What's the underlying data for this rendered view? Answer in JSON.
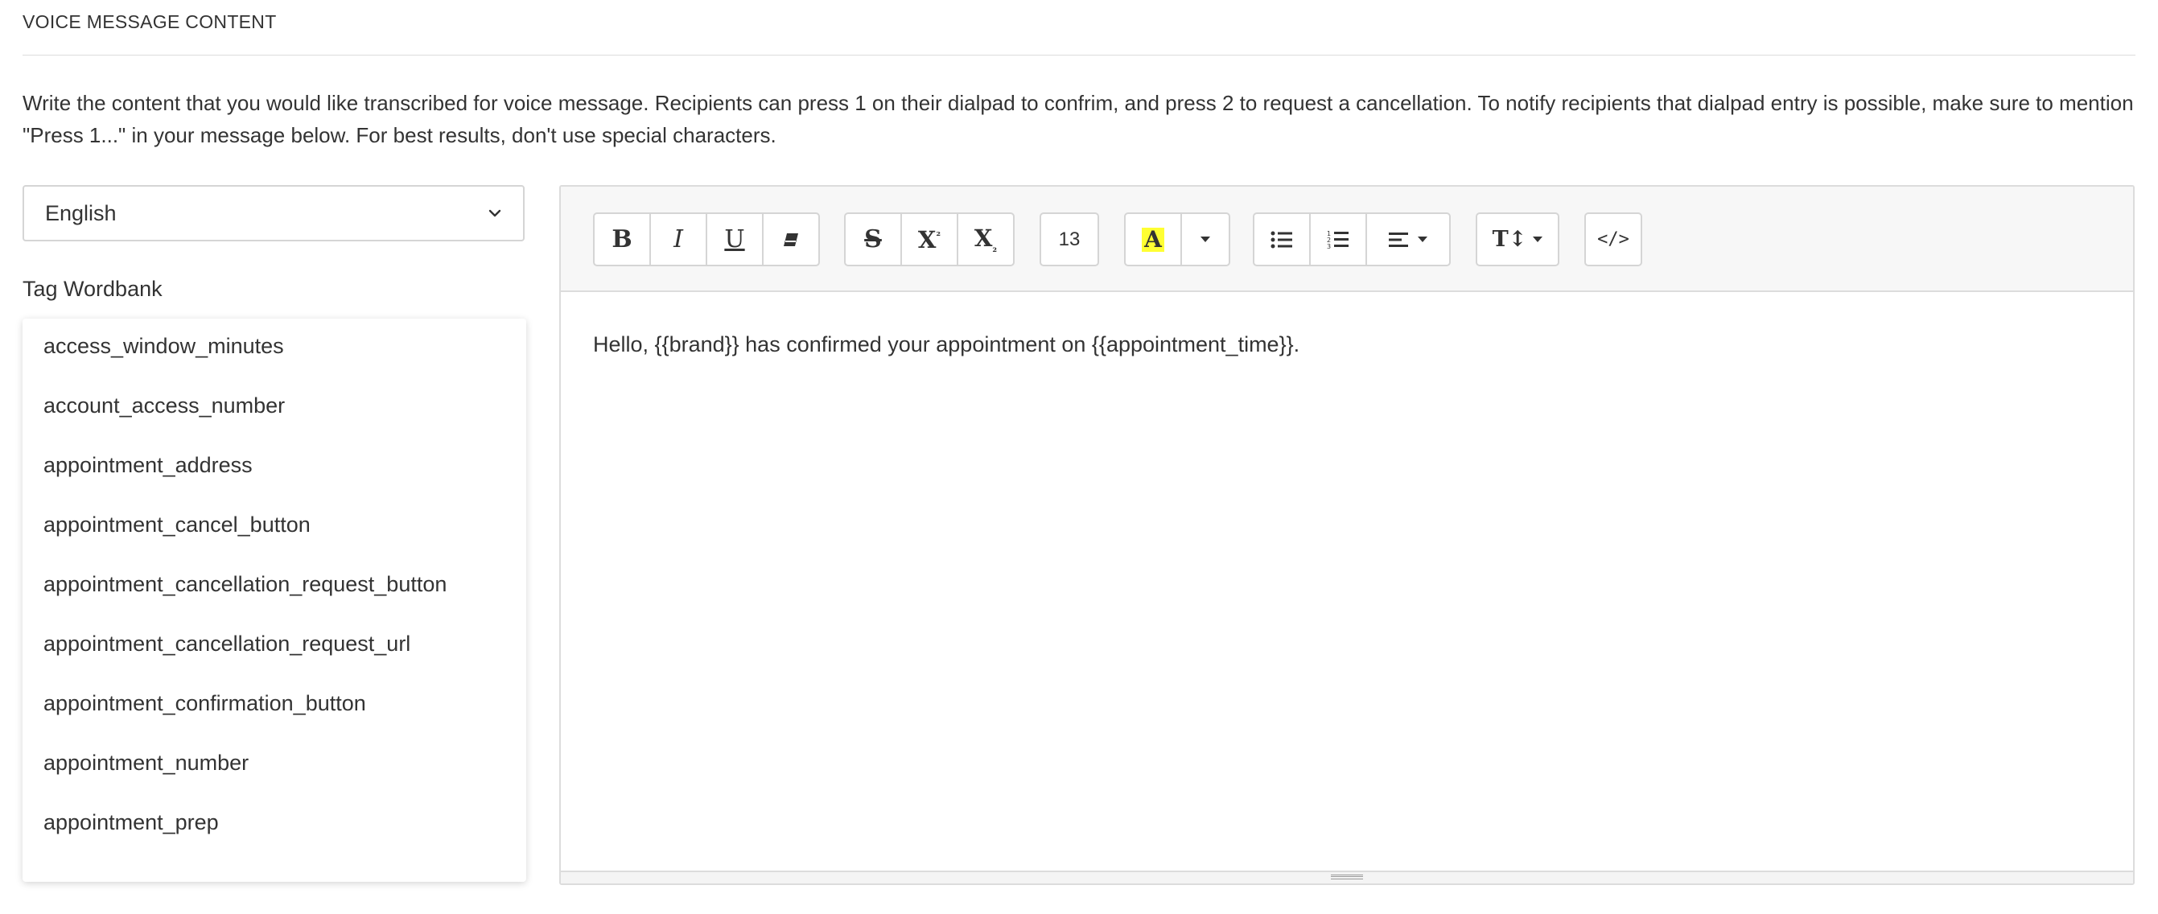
{
  "section": {
    "title": "VOICE MESSAGE CONTENT",
    "description": "Write the content that you would like transcribed for voice message. Recipients can press 1 on their dialpad to confrim, and press 2 to request a cancellation. To notify recipients that dialpad entry is possible, make sure to mention \"Press 1...\" in your message below. For best results, don't use special characters."
  },
  "language_select": {
    "value": "English",
    "icon": "chevron-down-icon"
  },
  "wordbank": {
    "label": "Tag Wordbank",
    "items": [
      "access_window_minutes",
      "account_access_number",
      "appointment_address",
      "appointment_cancel_button",
      "appointment_cancellation_request_button",
      "appointment_cancellation_request_url",
      "appointment_confirmation_button",
      "appointment_number",
      "appointment_prep"
    ]
  },
  "toolbar": {
    "bold": "B",
    "italic": "I",
    "underline": "U",
    "eraser_icon": "eraser-icon",
    "strikethrough": "S",
    "superscript": "X",
    "superscript_mark": "²",
    "subscript": "X",
    "subscript_mark": "₂",
    "font_size": "13",
    "highlight": "A",
    "highlight_color": "#ffff33",
    "bullet_list_icon": "bullet-list-icon",
    "numbered_list_icon": "numbered-list-icon",
    "align_icon": "align-left-icon",
    "text_height": "T↕",
    "code_view": "</>"
  },
  "editor": {
    "content": "Hello, {{brand}} has confirmed your appointment on {{appointment_time}}."
  }
}
